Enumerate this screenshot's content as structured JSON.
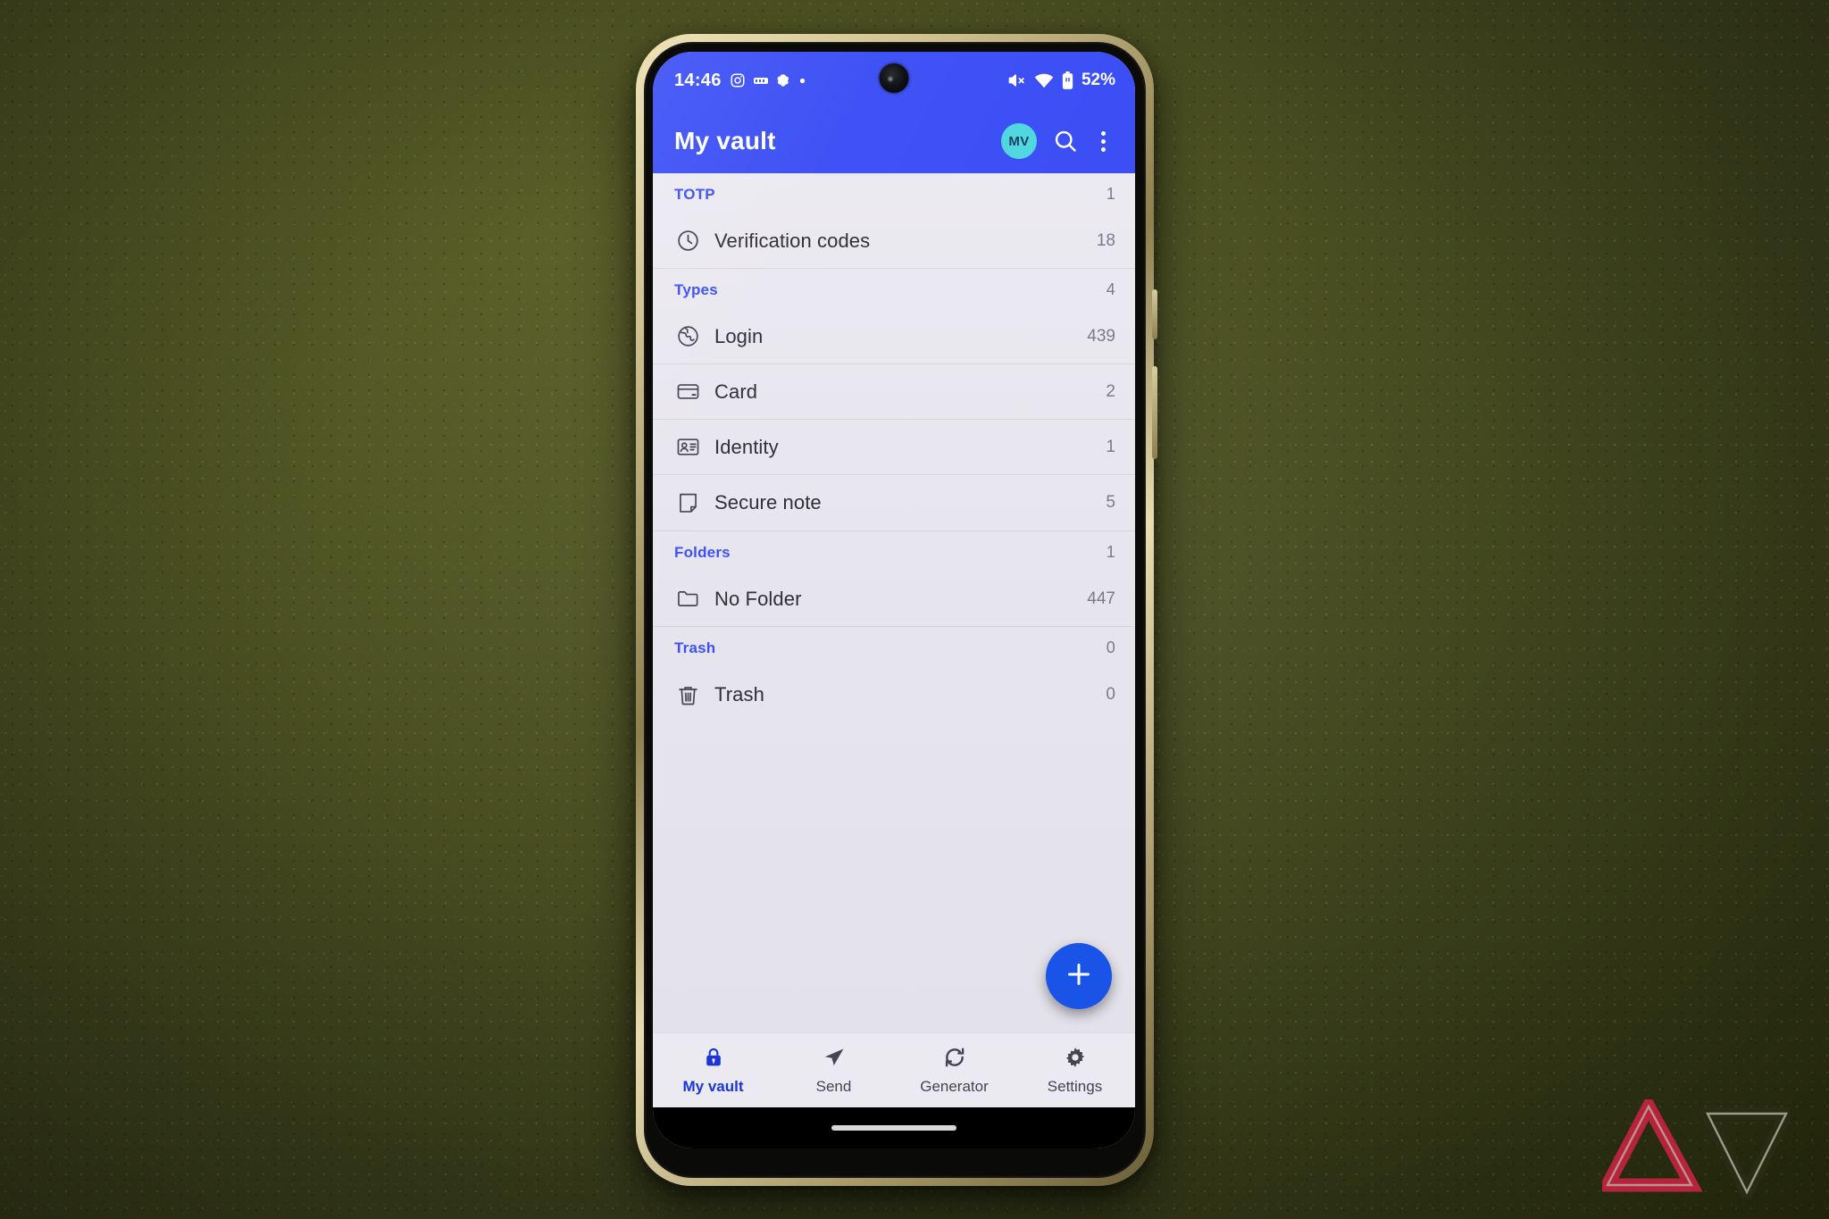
{
  "statusbar": {
    "time": "14:46",
    "left_icons": [
      "instagram-icon",
      "notification-badge-icon",
      "app-notification-icon",
      "notification-dot-icon"
    ],
    "right_icons": [
      "mute-icon",
      "wifi-icon",
      "battery-icon"
    ],
    "battery_text": "52%"
  },
  "appbar": {
    "title": "My vault",
    "avatar_initials": "MV",
    "search_icon": "search-icon",
    "overflow_icon": "overflow-menu-icon"
  },
  "vault": {
    "sections": [
      {
        "header": "TOTP",
        "header_count": "1",
        "items": [
          {
            "icon": "clock-icon",
            "label": "Verification codes",
            "count": "18"
          }
        ]
      },
      {
        "header": "Types",
        "header_count": "4",
        "items": [
          {
            "icon": "globe-icon",
            "label": "Login",
            "count": "439"
          },
          {
            "icon": "card-icon",
            "label": "Card",
            "count": "2"
          },
          {
            "icon": "identity-icon",
            "label": "Identity",
            "count": "1"
          },
          {
            "icon": "note-icon",
            "label": "Secure note",
            "count": "5"
          }
        ]
      },
      {
        "header": "Folders",
        "header_count": "1",
        "items": [
          {
            "icon": "folder-icon",
            "label": "No Folder",
            "count": "447"
          }
        ]
      },
      {
        "header": "Trash",
        "header_count": "0",
        "items": [
          {
            "icon": "trash-icon",
            "label": "Trash",
            "count": "0"
          }
        ]
      }
    ]
  },
  "fab": {
    "icon": "plus-icon"
  },
  "bottomnav": {
    "items": [
      {
        "icon": "lock-icon",
        "label": "My vault",
        "active": true
      },
      {
        "icon": "send-icon",
        "label": "Send",
        "active": false
      },
      {
        "icon": "generator-icon",
        "label": "Generator",
        "active": false
      },
      {
        "icon": "settings-gear-icon",
        "label": "Settings",
        "active": false
      }
    ]
  },
  "colors": {
    "accent_blue": "#3b4ff5",
    "fab_blue": "#1a53e8",
    "avatar_cyan": "#4fd7e0",
    "list_bg": "#eceaf1",
    "background_green": "#4b5022",
    "watermark_red": "#c2243f"
  },
  "watermark": {
    "name": "android-police-logo"
  }
}
